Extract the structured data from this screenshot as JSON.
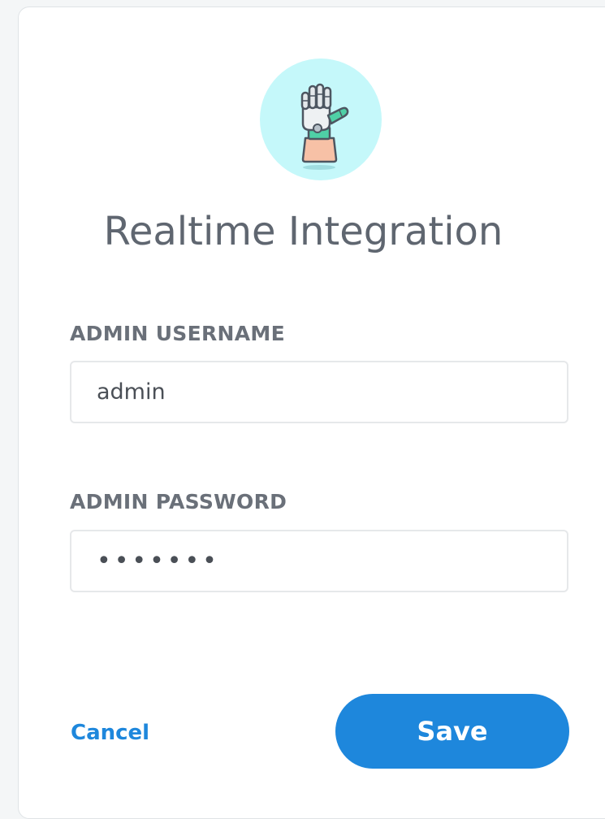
{
  "header": {
    "title": "Realtime Integration",
    "icon": "robot-hand-icon"
  },
  "form": {
    "username": {
      "label": "ADMIN USERNAME",
      "value": "admin"
    },
    "password": {
      "label": "ADMIN PASSWORD",
      "value": "•••••••"
    }
  },
  "actions": {
    "cancel_label": "Cancel",
    "save_label": "Save"
  },
  "colors": {
    "accent": "#1e87dc",
    "avatar_bg": "#c5f8fa",
    "title_text": "#5f6670"
  }
}
